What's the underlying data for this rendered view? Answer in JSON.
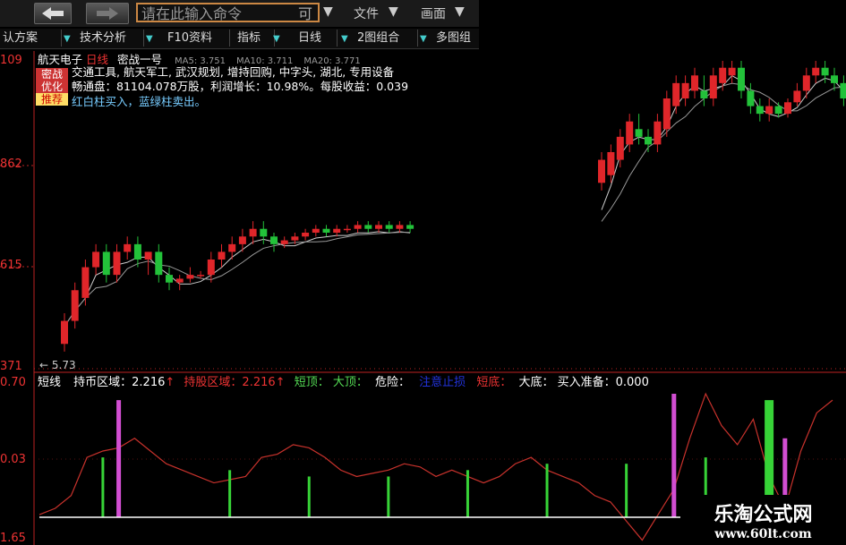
{
  "toolbar": {
    "back_icon": "back-arrow-icon",
    "forward_icon": "forward-arrow-icon",
    "command_placeholder": "请在此输入命令",
    "command_tail": "可",
    "file_menu": "文件",
    "view_menu": "画面"
  },
  "tabs": [
    {
      "label": "认方案"
    },
    {
      "label": "技术分析"
    },
    {
      "label": "F10资料"
    },
    {
      "label": "指标"
    },
    {
      "label": "日线"
    },
    {
      "label": "2图组合"
    },
    {
      "label": "多图组"
    }
  ],
  "stock": {
    "name": "航天电子",
    "period": "日线",
    "formula": "密战一号",
    "ma5": "MA5: 3.751",
    "ma10": "MA10: 3.711",
    "ma20": "MA20: 3.771",
    "concepts": "交通工具, 航天军工, 武汉规划, 增持回购, 中字头, 湖北, 专用设备",
    "float_shares": "畅通盘：81104.078万股，利润增长：10.98%。每股收益：0.039",
    "hint": "红白柱买入，蓝绿柱卖出。",
    "badge_line1": "密战",
    "badge_line2": "优化",
    "badge_line3": "推荐"
  },
  "price_axis": {
    "labels": [
      "109",
      "862",
      "615",
      "371"
    ],
    "low_marker": "← 5.73"
  },
  "indicator": {
    "name": "短线",
    "hold_label": "持币区域：2.216",
    "hold_arrow": "↑",
    "hold_stock_label": "持股区域：2.216",
    "hold_stock_arrow": "↑",
    "short_label": "短顶：",
    "big_top_label": "大顶：",
    "danger_label": "危险：",
    "caution_label": "注意止损",
    "short_bottom_label": "短底：",
    "big_bottom_label": "大底：",
    "buy_ready_label": "买入准备：0.000",
    "axis": [
      "0.70",
      "0.03",
      "1.65"
    ]
  },
  "watermark": {
    "title": "乐淘公式网",
    "url": "www.60lt.com"
  },
  "colors": {
    "up": "#e0262a",
    "down": "#23c23a",
    "indicator_line": "#c8322c",
    "pink": "#d24ed2",
    "green": "#37d337",
    "base": "#ffffff",
    "bg": "#000000"
  },
  "chart_data": [
    {
      "type": "candlestick",
      "title": "航天电子 日线",
      "ylim": [
        3.71,
        4.109
      ],
      "candles": [
        {
          "o": 3.74,
          "c": 3.77,
          "h": 3.78,
          "l": 3.73
        },
        {
          "o": 3.77,
          "c": 3.81,
          "h": 3.82,
          "l": 3.76
        },
        {
          "o": 3.8,
          "c": 3.84,
          "h": 3.85,
          "l": 3.79
        },
        {
          "o": 3.84,
          "c": 3.86,
          "h": 3.87,
          "l": 3.83
        },
        {
          "o": 3.86,
          "c": 3.83,
          "h": 3.87,
          "l": 3.82
        },
        {
          "o": 3.83,
          "c": 3.86,
          "h": 3.87,
          "l": 3.82
        },
        {
          "o": 3.86,
          "c": 3.87,
          "h": 3.88,
          "l": 3.85
        },
        {
          "o": 3.87,
          "c": 3.85,
          "h": 3.88,
          "l": 3.84
        },
        {
          "o": 3.85,
          "c": 3.86,
          "h": 3.86,
          "l": 3.83
        },
        {
          "o": 3.86,
          "c": 3.83,
          "h": 3.87,
          "l": 3.82
        },
        {
          "o": 3.83,
          "c": 3.82,
          "h": 3.84,
          "l": 3.81
        },
        {
          "o": 3.82,
          "c": 3.825,
          "h": 3.83,
          "l": 3.81
        },
        {
          "o": 3.825,
          "c": 3.83,
          "h": 3.84,
          "l": 3.82
        },
        {
          "o": 3.83,
          "c": 3.83,
          "h": 3.835,
          "l": 3.825
        },
        {
          "o": 3.83,
          "c": 3.85,
          "h": 3.86,
          "l": 3.82
        },
        {
          "o": 3.85,
          "c": 3.86,
          "h": 3.87,
          "l": 3.84
        },
        {
          "o": 3.86,
          "c": 3.87,
          "h": 3.88,
          "l": 3.85
        },
        {
          "o": 3.87,
          "c": 3.88,
          "h": 3.89,
          "l": 3.86
        },
        {
          "o": 3.88,
          "c": 3.89,
          "h": 3.9,
          "l": 3.87
        },
        {
          "o": 3.89,
          "c": 3.88,
          "h": 3.9,
          "l": 3.87
        },
        {
          "o": 3.88,
          "c": 3.87,
          "h": 3.885,
          "l": 3.86
        },
        {
          "o": 3.87,
          "c": 3.875,
          "h": 3.88,
          "l": 3.865
        },
        {
          "o": 3.875,
          "c": 3.88,
          "h": 3.885,
          "l": 3.87
        },
        {
          "o": 3.88,
          "c": 3.885,
          "h": 3.89,
          "l": 3.875
        },
        {
          "o": 3.885,
          "c": 3.89,
          "h": 3.895,
          "l": 3.88
        },
        {
          "o": 3.89,
          "c": 3.885,
          "h": 3.895,
          "l": 3.88
        },
        {
          "o": 3.885,
          "c": 3.89,
          "h": 3.895,
          "l": 3.88
        },
        {
          "o": 3.89,
          "c": 3.89,
          "h": 3.895,
          "l": 3.885
        },
        {
          "o": 3.89,
          "c": 3.895,
          "h": 3.9,
          "l": 3.885
        },
        {
          "o": 3.895,
          "c": 3.89,
          "h": 3.9,
          "l": 3.885
        },
        {
          "o": 3.89,
          "c": 3.895,
          "h": 3.9,
          "l": 3.885
        },
        {
          "o": 3.895,
          "c": 3.89,
          "h": 3.9,
          "l": 3.885
        },
        {
          "o": 3.89,
          "c": 3.895,
          "h": 3.9,
          "l": 3.885
        },
        {
          "o": 3.895,
          "c": 3.89,
          "h": 3.9,
          "l": 3.885
        },
        {
          "o": 3.95,
          "c": 3.98,
          "h": 3.99,
          "l": 3.94
        },
        {
          "o": 3.96,
          "c": 3.99,
          "h": 4.0,
          "l": 3.95
        },
        {
          "o": 3.98,
          "c": 4.01,
          "h": 4.02,
          "l": 3.97
        },
        {
          "o": 4.0,
          "c": 4.03,
          "h": 4.04,
          "l": 3.99
        },
        {
          "o": 4.02,
          "c": 4.01,
          "h": 4.04,
          "l": 4.0
        },
        {
          "o": 4.01,
          "c": 4.0,
          "h": 4.02,
          "l": 3.99
        },
        {
          "o": 4.0,
          "c": 4.03,
          "h": 4.04,
          "l": 3.99
        },
        {
          "o": 4.02,
          "c": 4.06,
          "h": 4.07,
          "l": 4.01
        },
        {
          "o": 4.05,
          "c": 4.08,
          "h": 4.09,
          "l": 4.04
        },
        {
          "o": 4.06,
          "c": 4.08,
          "h": 4.09,
          "l": 4.05
        },
        {
          "o": 4.07,
          "c": 4.09,
          "h": 4.1,
          "l": 4.06
        },
        {
          "o": 4.07,
          "c": 4.06,
          "h": 4.09,
          "l": 4.05
        },
        {
          "o": 4.06,
          "c": 4.09,
          "h": 4.1,
          "l": 4.05
        },
        {
          "o": 4.08,
          "c": 4.1,
          "h": 4.109,
          "l": 4.07
        },
        {
          "o": 4.09,
          "c": 4.1,
          "h": 4.109,
          "l": 4.08
        },
        {
          "o": 4.1,
          "c": 4.07,
          "h": 4.109,
          "l": 4.06
        },
        {
          "o": 4.07,
          "c": 4.05,
          "h": 4.08,
          "l": 4.04
        },
        {
          "o": 4.05,
          "c": 4.04,
          "h": 4.06,
          "l": 4.03
        },
        {
          "o": 4.04,
          "c": 4.05,
          "h": 4.06,
          "l": 4.03
        },
        {
          "o": 4.05,
          "c": 4.04,
          "h": 4.055,
          "l": 4.035
        },
        {
          "o": 4.04,
          "c": 4.055,
          "h": 4.06,
          "l": 4.035
        },
        {
          "o": 4.055,
          "c": 4.07,
          "h": 4.08,
          "l": 4.05
        },
        {
          "o": 4.07,
          "c": 4.09,
          "h": 4.1,
          "l": 4.06
        },
        {
          "o": 4.09,
          "c": 4.1,
          "h": 4.109,
          "l": 4.08
        },
        {
          "o": 4.1,
          "c": 4.09,
          "h": 4.109,
          "l": 4.08
        },
        {
          "o": 4.09,
          "c": 4.08,
          "h": 4.1,
          "l": 4.07
        },
        {
          "o": 4.08,
          "c": 4.06,
          "h": 4.09,
          "l": 4.05
        },
        {
          "o": 4.06,
          "c": 4.08,
          "h": 4.09,
          "l": 4.05
        }
      ]
    },
    {
      "type": "line",
      "title": "短线",
      "ylim": [
        1.65,
        3.9
      ],
      "line": [
        2.0,
        2.1,
        2.3,
        2.9,
        3.0,
        3.05,
        3.2,
        3.0,
        2.8,
        2.7,
        2.6,
        2.5,
        2.55,
        2.6,
        2.9,
        2.95,
        3.1,
        3.05,
        2.9,
        2.7,
        2.6,
        2.65,
        2.7,
        2.8,
        2.75,
        2.6,
        2.7,
        2.6,
        2.5,
        2.6,
        2.8,
        2.9,
        2.7,
        2.6,
        2.5,
        2.3,
        2.2,
        1.9,
        1.6,
        2.0,
        2.4,
        3.2,
        3.9,
        3.4,
        3.1,
        3.5,
        2.6,
        2.1,
        3.0,
        3.6,
        3.8
      ],
      "pink_bars": [
        {
          "i": 5,
          "v": 3.8
        },
        {
          "i": 40,
          "v": 3.9
        },
        {
          "i": 47,
          "v": 3.2
        }
      ],
      "green_bars": [
        {
          "i": 4,
          "v": 2.9
        },
        {
          "i": 12,
          "v": 2.7
        },
        {
          "i": 17,
          "v": 2.6
        },
        {
          "i": 22,
          "v": 2.6
        },
        {
          "i": 27,
          "v": 2.7
        },
        {
          "i": 32,
          "v": 2.8
        },
        {
          "i": 37,
          "v": 2.8
        },
        {
          "i": 42,
          "v": 2.9
        },
        {
          "i": 46,
          "v": 3.8
        }
      ]
    }
  ]
}
